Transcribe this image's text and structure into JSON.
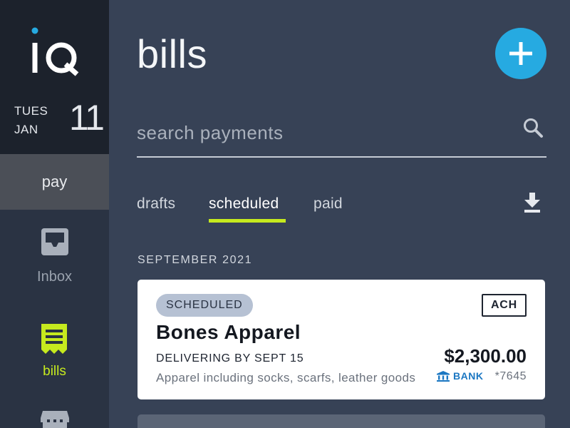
{
  "colors": {
    "sidebar_bg": "#2a3343",
    "main_bg": "#374256",
    "accent_green": "#c6ea1e",
    "accent_blue": "#26aae1",
    "bank_blue": "#1b77c2"
  },
  "sidebar": {
    "logo_text": "iQ",
    "date": {
      "day": "TUES",
      "month": "JAN",
      "number": "11"
    },
    "items": [
      {
        "label": "pay",
        "icon": null,
        "selected": true
      },
      {
        "label": "Inbox",
        "icon": "inbox-icon",
        "selected": false
      },
      {
        "label": "bills",
        "icon": "receipt-icon",
        "selected": false,
        "highlighted": true
      },
      {
        "label": "",
        "icon": "store-icon",
        "selected": false
      }
    ]
  },
  "main": {
    "title": "bills",
    "add_button_icon": "plus-icon",
    "search": {
      "placeholder": "search payments",
      "value": ""
    },
    "tabs": [
      {
        "label": "drafts",
        "active": false
      },
      {
        "label": "scheduled",
        "active": true
      },
      {
        "label": "paid",
        "active": false
      }
    ],
    "download_icon": "download-icon",
    "section_header": "SEPTEMBER 2021",
    "payments": [
      {
        "status": "SCHEDULED",
        "method": "ACH",
        "vendor": "Bones Apparel",
        "delivery": "DELIVERING BY SEPT 15",
        "description": "Apparel including socks, scarfs, leather goods",
        "amount": "$2,300.00",
        "account_type": "BANK",
        "account_number": "*7645"
      }
    ]
  }
}
